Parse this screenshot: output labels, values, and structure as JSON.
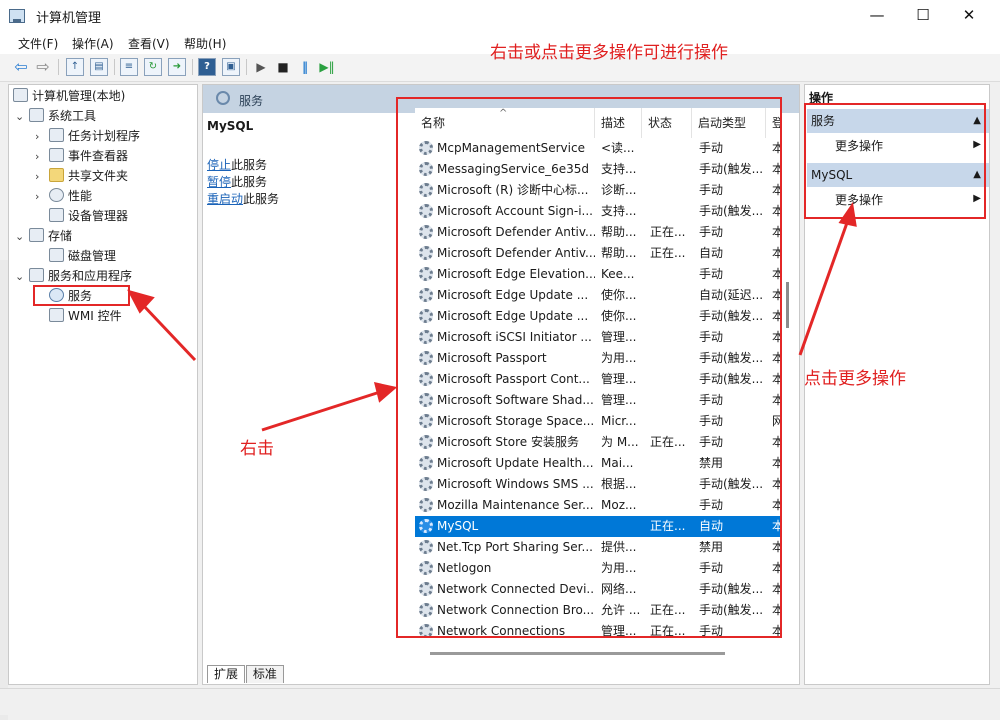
{
  "window": {
    "title": "计算机管理",
    "controls": {
      "minimize": "—",
      "maximize": "☐",
      "close": "✕"
    }
  },
  "menu": [
    "文件(F)",
    "操作(A)",
    "查看(V)",
    "帮助(H)"
  ],
  "toolbar_icons": [
    "back-icon",
    "forward-icon",
    "up-folder-icon",
    "show-tree-icon",
    "properties-icon",
    "refresh-icon",
    "export-icon",
    "help-icon",
    "console-icon",
    "start-service-icon",
    "stop-service-icon",
    "pause-service-icon",
    "restart-service-icon"
  ],
  "annotations": {
    "top": "右击或点击更多操作可进行操作",
    "right_click": "右击",
    "click_more": "点击更多操作"
  },
  "tree": {
    "items": [
      {
        "label": "计算机管理(本地)"
      },
      {
        "label": "系统工具"
      },
      {
        "label": "任务计划程序"
      },
      {
        "label": "事件查看器"
      },
      {
        "label": "共享文件夹"
      },
      {
        "label": "性能"
      },
      {
        "label": "设备管理器"
      },
      {
        "label": "存储"
      },
      {
        "label": "磁盘管理"
      },
      {
        "label": "服务和应用程序"
      },
      {
        "label": "服务"
      },
      {
        "label": "WMI 控件"
      }
    ]
  },
  "center": {
    "header": "服务",
    "detail_title": "MySQL",
    "links": [
      {
        "link": "停止",
        "rest": "此服务"
      },
      {
        "link": "暂停",
        "rest": "此服务"
      },
      {
        "link": "重启动",
        "rest": "此服务"
      }
    ],
    "tabs": [
      "扩展",
      "标准"
    ]
  },
  "list": {
    "columns": [
      "名称",
      "描述",
      "状态",
      "启动类型",
      "登"
    ],
    "rows": [
      {
        "name": "McpManagementService",
        "desc": "<读...",
        "status": "",
        "startup": "手动",
        "logon": "本"
      },
      {
        "name": "MessagingService_6e35d",
        "desc": "支持...",
        "status": "",
        "startup": "手动(触发...",
        "logon": "本"
      },
      {
        "name": "Microsoft (R) 诊断中心标...",
        "desc": "诊断...",
        "status": "",
        "startup": "手动",
        "logon": "本"
      },
      {
        "name": "Microsoft Account Sign-i...",
        "desc": "支持...",
        "status": "",
        "startup": "手动(触发...",
        "logon": "本"
      },
      {
        "name": "Microsoft Defender Antiv...",
        "desc": "帮助...",
        "status": "正在...",
        "startup": "手动",
        "logon": "本"
      },
      {
        "name": "Microsoft Defender Antiv...",
        "desc": "帮助...",
        "status": "正在...",
        "startup": "自动",
        "logon": "本"
      },
      {
        "name": "Microsoft Edge Elevation...",
        "desc": "Kee...",
        "status": "",
        "startup": "手动",
        "logon": "本"
      },
      {
        "name": "Microsoft Edge Update ...",
        "desc": "使你...",
        "status": "",
        "startup": "自动(延迟...",
        "logon": "本"
      },
      {
        "name": "Microsoft Edge Update ...",
        "desc": "使你...",
        "status": "",
        "startup": "手动(触发...",
        "logon": "本"
      },
      {
        "name": "Microsoft iSCSI Initiator ...",
        "desc": "管理...",
        "status": "",
        "startup": "手动",
        "logon": "本"
      },
      {
        "name": "Microsoft Passport",
        "desc": "为用...",
        "status": "",
        "startup": "手动(触发...",
        "logon": "本"
      },
      {
        "name": "Microsoft Passport Cont...",
        "desc": "管理...",
        "status": "",
        "startup": "手动(触发...",
        "logon": "本"
      },
      {
        "name": "Microsoft Software Shad...",
        "desc": "管理...",
        "status": "",
        "startup": "手动",
        "logon": "本"
      },
      {
        "name": "Microsoft Storage Space...",
        "desc": "Micr...",
        "status": "",
        "startup": "手动",
        "logon": "网"
      },
      {
        "name": "Microsoft Store 安装服务",
        "desc": "为 M...",
        "status": "正在...",
        "startup": "手动",
        "logon": "本"
      },
      {
        "name": "Microsoft Update Health...",
        "desc": "Mai...",
        "status": "",
        "startup": "禁用",
        "logon": "本"
      },
      {
        "name": "Microsoft Windows SMS ...",
        "desc": "根据...",
        "status": "",
        "startup": "手动(触发...",
        "logon": "本"
      },
      {
        "name": "Mozilla Maintenance Ser...",
        "desc": "Moz...",
        "status": "",
        "startup": "手动",
        "logon": "本"
      },
      {
        "name": "MySQL",
        "desc": "",
        "status": "正在...",
        "startup": "自动",
        "logon": "本",
        "selected": true
      },
      {
        "name": "Net.Tcp Port Sharing Ser...",
        "desc": "提供...",
        "status": "",
        "startup": "禁用",
        "logon": "本"
      },
      {
        "name": "Netlogon",
        "desc": "为用...",
        "status": "",
        "startup": "手动",
        "logon": "本"
      },
      {
        "name": "Network Connected Devi...",
        "desc": "网络...",
        "status": "",
        "startup": "手动(触发...",
        "logon": "本"
      },
      {
        "name": "Network Connection Bro...",
        "desc": "允许 ...",
        "status": "正在...",
        "startup": "手动(触发...",
        "logon": "本"
      },
      {
        "name": "Network Connections",
        "desc": "管理...",
        "status": "正在...",
        "startup": "手动",
        "logon": "本"
      }
    ]
  },
  "actions": {
    "title": "操作",
    "sections": [
      {
        "label": "服务",
        "more": "更多操作"
      },
      {
        "label": "MySQL",
        "more": "更多操作"
      }
    ]
  },
  "colors": {
    "annotation": "#e32727",
    "selection": "#0078d7",
    "pane_header": "#c5d3e2"
  }
}
